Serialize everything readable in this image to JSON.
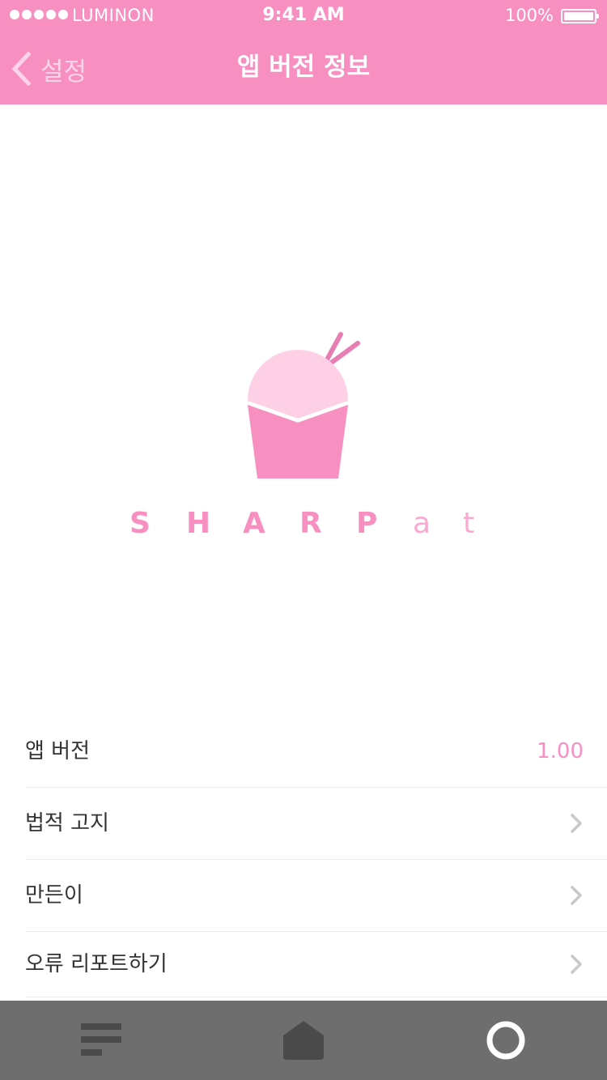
{
  "status_bar": {
    "carrier": "LUMINON",
    "time": "9:41 AM",
    "battery": "100%",
    "signal_bars": 5,
    "battery_level": 1.0
  },
  "nav": {
    "back_label": "설정",
    "title": "앱 버전 정보",
    "back_icon": "chevron-left-icon"
  },
  "brand": {
    "logo_icon": "shaved-ice-cup-logo",
    "name_bold": [
      "S",
      "H",
      "A",
      "R",
      "P"
    ],
    "name_light": [
      "a",
      "t"
    ]
  },
  "info_list": [
    {
      "label": "앱 버전",
      "value": "1.00"
    },
    {
      "label": "법적 고지",
      "icon": "chevron-right-icon"
    },
    {
      "label": "만든이",
      "icon": "chevron-right-icon"
    },
    {
      "label": "오류 리포트하기",
      "icon": "chevron-right-icon"
    }
  ],
  "tab_bar": {
    "tabs": [
      {
        "icon": "menu-lines-icon"
      },
      {
        "icon": "home-icon"
      },
      {
        "icon": "circle-icon"
      }
    ]
  },
  "colors": {
    "accent": "#f78fc1",
    "accent_light": "#fcd3e8",
    "tab_bar": "#6e6e6e",
    "text": "#333333",
    "divider": "#ececec"
  }
}
